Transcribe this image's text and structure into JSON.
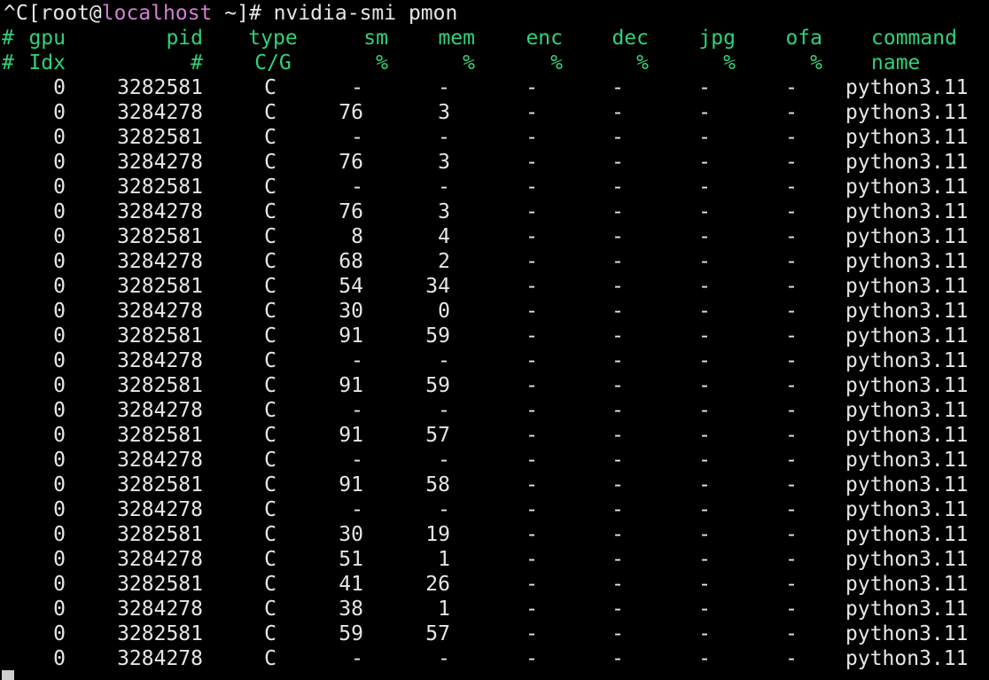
{
  "prompt": {
    "prefix": "^C[root@",
    "host": "localhost",
    "suffix": " ~]# nvidia-smi pmon"
  },
  "headers": [
    {
      "hash": "#",
      "gpu": "gpu",
      "pid": "pid",
      "type": "type",
      "sm": "sm",
      "mem": "mem",
      "enc": "enc",
      "dec": "dec",
      "jpg": "jpg",
      "ofa": "ofa",
      "command": "command"
    },
    {
      "hash": "#",
      "gpu": "Idx",
      "pid": "#",
      "type": "C/G",
      "sm": "%",
      "mem": "%",
      "enc": "%",
      "dec": "%",
      "jpg": "%",
      "ofa": "%",
      "command": "name"
    }
  ],
  "rows": [
    {
      "gpu": "0",
      "pid": "3282581",
      "type": "C",
      "sm": "-",
      "mem": "-",
      "enc": "-",
      "dec": "-",
      "jpg": "-",
      "ofa": "-",
      "command": "python3.11"
    },
    {
      "gpu": "0",
      "pid": "3284278",
      "type": "C",
      "sm": "76",
      "mem": "3",
      "enc": "-",
      "dec": "-",
      "jpg": "-",
      "ofa": "-",
      "command": "python3.11"
    },
    {
      "gpu": "0",
      "pid": "3282581",
      "type": "C",
      "sm": "-",
      "mem": "-",
      "enc": "-",
      "dec": "-",
      "jpg": "-",
      "ofa": "-",
      "command": "python3.11"
    },
    {
      "gpu": "0",
      "pid": "3284278",
      "type": "C",
      "sm": "76",
      "mem": "3",
      "enc": "-",
      "dec": "-",
      "jpg": "-",
      "ofa": "-",
      "command": "python3.11"
    },
    {
      "gpu": "0",
      "pid": "3282581",
      "type": "C",
      "sm": "-",
      "mem": "-",
      "enc": "-",
      "dec": "-",
      "jpg": "-",
      "ofa": "-",
      "command": "python3.11"
    },
    {
      "gpu": "0",
      "pid": "3284278",
      "type": "C",
      "sm": "76",
      "mem": "3",
      "enc": "-",
      "dec": "-",
      "jpg": "-",
      "ofa": "-",
      "command": "python3.11"
    },
    {
      "gpu": "0",
      "pid": "3282581",
      "type": "C",
      "sm": "8",
      "mem": "4",
      "enc": "-",
      "dec": "-",
      "jpg": "-",
      "ofa": "-",
      "command": "python3.11"
    },
    {
      "gpu": "0",
      "pid": "3284278",
      "type": "C",
      "sm": "68",
      "mem": "2",
      "enc": "-",
      "dec": "-",
      "jpg": "-",
      "ofa": "-",
      "command": "python3.11"
    },
    {
      "gpu": "0",
      "pid": "3282581",
      "type": "C",
      "sm": "54",
      "mem": "34",
      "enc": "-",
      "dec": "-",
      "jpg": "-",
      "ofa": "-",
      "command": "python3.11"
    },
    {
      "gpu": "0",
      "pid": "3284278",
      "type": "C",
      "sm": "30",
      "mem": "0",
      "enc": "-",
      "dec": "-",
      "jpg": "-",
      "ofa": "-",
      "command": "python3.11"
    },
    {
      "gpu": "0",
      "pid": "3282581",
      "type": "C",
      "sm": "91",
      "mem": "59",
      "enc": "-",
      "dec": "-",
      "jpg": "-",
      "ofa": "-",
      "command": "python3.11"
    },
    {
      "gpu": "0",
      "pid": "3284278",
      "type": "C",
      "sm": "-",
      "mem": "-",
      "enc": "-",
      "dec": "-",
      "jpg": "-",
      "ofa": "-",
      "command": "python3.11"
    },
    {
      "gpu": "0",
      "pid": "3282581",
      "type": "C",
      "sm": "91",
      "mem": "59",
      "enc": "-",
      "dec": "-",
      "jpg": "-",
      "ofa": "-",
      "command": "python3.11"
    },
    {
      "gpu": "0",
      "pid": "3284278",
      "type": "C",
      "sm": "-",
      "mem": "-",
      "enc": "-",
      "dec": "-",
      "jpg": "-",
      "ofa": "-",
      "command": "python3.11"
    },
    {
      "gpu": "0",
      "pid": "3282581",
      "type": "C",
      "sm": "91",
      "mem": "57",
      "enc": "-",
      "dec": "-",
      "jpg": "-",
      "ofa": "-",
      "command": "python3.11"
    },
    {
      "gpu": "0",
      "pid": "3284278",
      "type": "C",
      "sm": "-",
      "mem": "-",
      "enc": "-",
      "dec": "-",
      "jpg": "-",
      "ofa": "-",
      "command": "python3.11"
    },
    {
      "gpu": "0",
      "pid": "3282581",
      "type": "C",
      "sm": "91",
      "mem": "58",
      "enc": "-",
      "dec": "-",
      "jpg": "-",
      "ofa": "-",
      "command": "python3.11"
    },
    {
      "gpu": "0",
      "pid": "3284278",
      "type": "C",
      "sm": "-",
      "mem": "-",
      "enc": "-",
      "dec": "-",
      "jpg": "-",
      "ofa": "-",
      "command": "python3.11"
    },
    {
      "gpu": "0",
      "pid": "3282581",
      "type": "C",
      "sm": "30",
      "mem": "19",
      "enc": "-",
      "dec": "-",
      "jpg": "-",
      "ofa": "-",
      "command": "python3.11"
    },
    {
      "gpu": "0",
      "pid": "3284278",
      "type": "C",
      "sm": "51",
      "mem": "1",
      "enc": "-",
      "dec": "-",
      "jpg": "-",
      "ofa": "-",
      "command": "python3.11"
    },
    {
      "gpu": "0",
      "pid": "3282581",
      "type": "C",
      "sm": "41",
      "mem": "26",
      "enc": "-",
      "dec": "-",
      "jpg": "-",
      "ofa": "-",
      "command": "python3.11"
    },
    {
      "gpu": "0",
      "pid": "3284278",
      "type": "C",
      "sm": "38",
      "mem": "1",
      "enc": "-",
      "dec": "-",
      "jpg": "-",
      "ofa": "-",
      "command": "python3.11"
    },
    {
      "gpu": "0",
      "pid": "3282581",
      "type": "C",
      "sm": "59",
      "mem": "57",
      "enc": "-",
      "dec": "-",
      "jpg": "-",
      "ofa": "-",
      "command": "python3.11"
    },
    {
      "gpu": "0",
      "pid": "3284278",
      "type": "C",
      "sm": "-",
      "mem": "-",
      "enc": "-",
      "dec": "-",
      "jpg": "-",
      "ofa": "-",
      "command": "python3.11"
    }
  ],
  "colors": {
    "background": "#000000",
    "text": "#e6e6e6",
    "header": "#2fd17b",
    "host": "#d37fd3",
    "cursor": "#cfcfcf"
  }
}
